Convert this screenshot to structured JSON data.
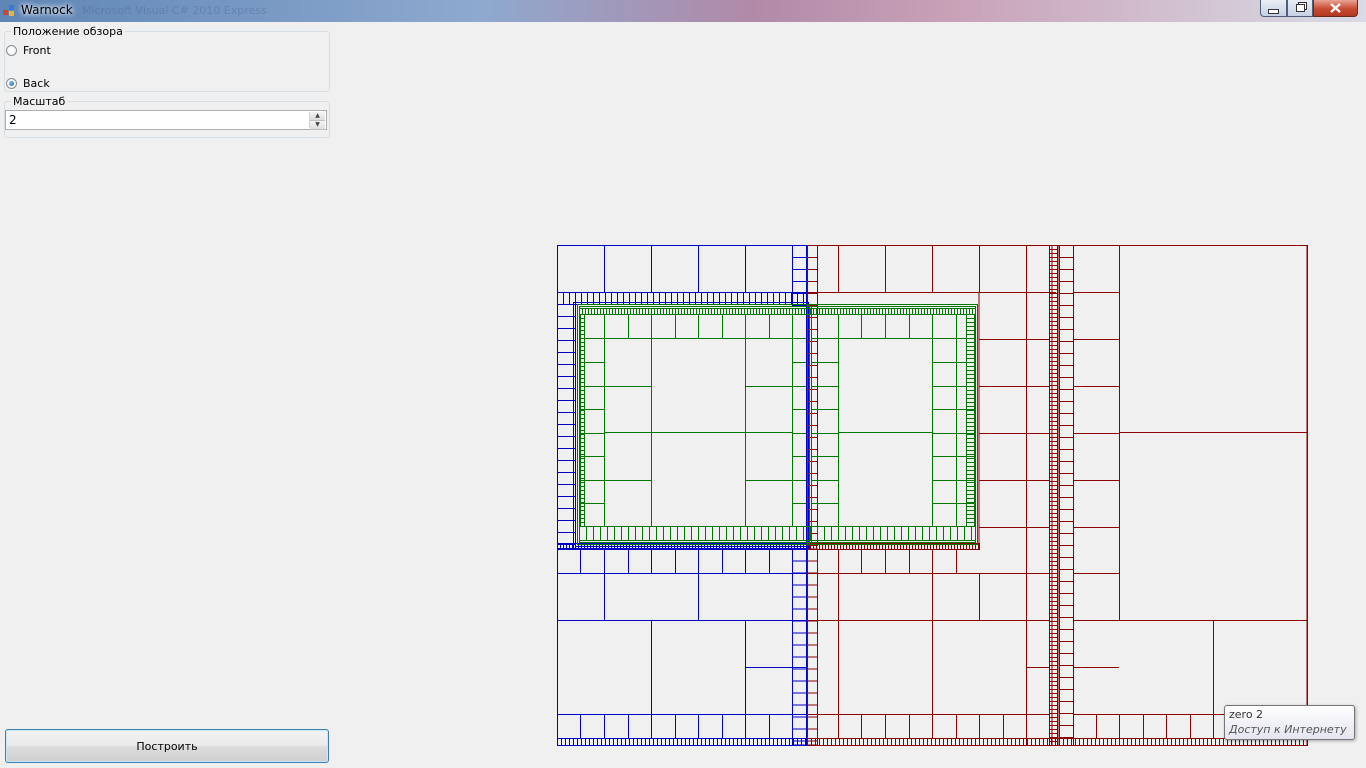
{
  "window": {
    "title": "Warnock",
    "background_title": "Microsoft Visual C# 2010 Express"
  },
  "view_group": {
    "label": "Положение обзора",
    "options": [
      {
        "label": "Front",
        "checked": false
      },
      {
        "label": "Back",
        "checked": true
      }
    ]
  },
  "scale_group": {
    "label": "Масштаб",
    "value": "2"
  },
  "build_button": {
    "label": "Построить"
  },
  "tooltip": {
    "line1": "zero  2",
    "line2": "Доступ к Интернету"
  },
  "colors": {
    "blue": "#0000c8",
    "red": "#8b0000",
    "green": "#007800"
  }
}
